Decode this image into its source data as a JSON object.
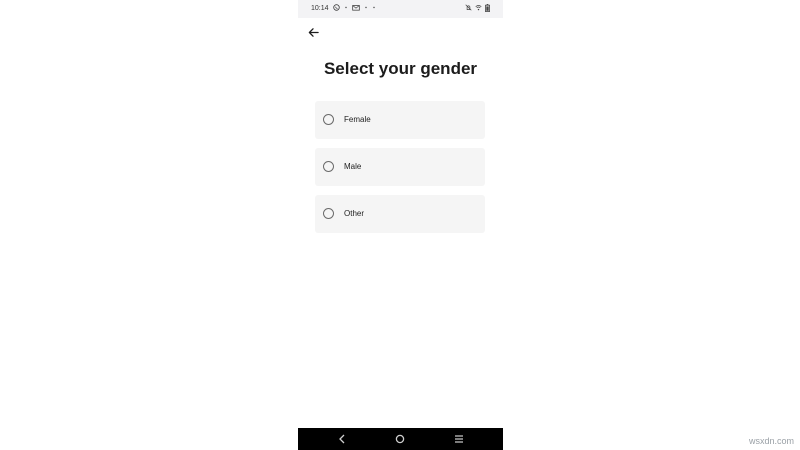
{
  "status_bar": {
    "time": "10:14",
    "left_icons": [
      "whatsapp-icon",
      "dot-icon",
      "mail-icon",
      "dot-icon",
      "dot-icon"
    ],
    "right_icons": [
      "mute-icon",
      "wifi-icon",
      "battery-icon"
    ]
  },
  "header": {
    "title": "Select your gender"
  },
  "options": [
    {
      "label": "Female",
      "selected": false
    },
    {
      "label": "Male",
      "selected": false
    },
    {
      "label": "Other",
      "selected": false
    }
  ],
  "nav_bar": {
    "buttons": [
      "back-nav-icon",
      "home-nav-icon",
      "recents-nav-icon"
    ]
  },
  "watermark": "wsxdn.com",
  "colors": {
    "option_bg": "#f5f5f5",
    "title": "#1c1c1c",
    "nav_bar": "#000000"
  }
}
